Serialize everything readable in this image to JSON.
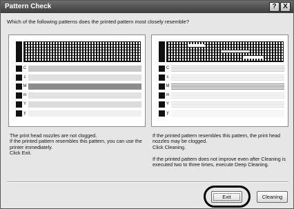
{
  "window": {
    "title": "Pattern Check",
    "help_label": "?",
    "close_label": "X"
  },
  "question": "Which of the following patterns does the printed pattern most closely resemble?",
  "patterns": {
    "left": {
      "k_label": "K",
      "rows": [
        {
          "label": "C",
          "bar_color": "#c8c8c8"
        },
        {
          "label": "c",
          "bar_color": "#e0e0e0"
        },
        {
          "label": "M",
          "bar_color": "#8c8c8c"
        },
        {
          "label": "m",
          "bar_color": "#e2e2e2"
        },
        {
          "label": "Y",
          "bar_color": "#dcdcdc"
        },
        {
          "label": "y",
          "bar_color": "#f0f0f0"
        }
      ]
    },
    "right": {
      "k_label": "K",
      "rows": [
        {
          "label": "C",
          "bar_color": "#c8c8c8"
        },
        {
          "label": "c",
          "bar_color": "#e0e0e0"
        },
        {
          "label": "M",
          "bar_color": "#8c8c8c"
        },
        {
          "label": "m",
          "bar_color": "#e2e2e2"
        },
        {
          "label": "Y",
          "bar_color": "#dcdcdc"
        },
        {
          "label": "y",
          "bar_color": "#f0f0f0"
        }
      ]
    }
  },
  "descriptions": {
    "left": "The print head nozzles are not clogged.\nIf the printed pattern resembles this pattern, you can use the printer immediately.\nClick Exit.",
    "right_1": "If the printed pattern resembles this pattern, the print head nozzles may be clogged.\nClick Cleaning.",
    "right_2": "If the printed pattern does not improve even after Cleaning is executed two to three times, execute Deep Cleaning."
  },
  "buttons": {
    "exit": "Exit",
    "cleaning": "Cleaning"
  }
}
